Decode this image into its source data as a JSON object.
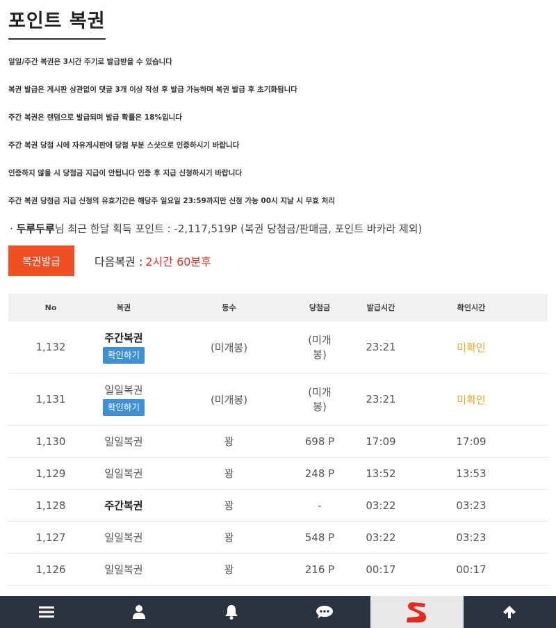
{
  "page": {
    "title": "포인트 복권"
  },
  "notices": [
    "일일/주간 복권은 3시간 주기로 발급받을 수 있습니다",
    "복권 발급은 게시판 상관없이 댓글 3개 이상 작성 후 발급 가능하며 복권 발급 후 초기화됩니다",
    "주간 복권은 랜덤으로 발급되며 발급 확률은 18%입니다",
    "주간 복권 당첨 시에 자유게시판에 당첨 부분 스샷으로 인증하시기 바랍니다",
    "인증하지 않을 시 당첨금 지급이 안됩니다 인증 후 지급 신청하시기 바랍니다",
    "주간 복권 당첨금 지급 신청의 유효기간은 해당주 일요일 23:59까지만 신청 가능 00시 지날 시 무효 처리"
  ],
  "summary": {
    "bullet": "·",
    "username": "두루두루",
    "text": "님 최근 한달 획득 포인트 : -2,117,519P (복권 당첨금/판매금, 포인트 바카라 제외)"
  },
  "issue": {
    "button_label": "복권발급",
    "next_label": "다음복권 :",
    "next_value": "2시간 60분후"
  },
  "table": {
    "headers": [
      "No",
      "복권",
      "등수",
      "당첨금",
      "발급시간",
      "확인시간"
    ],
    "check_button_label": "확인하기",
    "rows": [
      {
        "no": "1,132",
        "type": "주간복권",
        "bold": true,
        "button": true,
        "rank": "(미개봉)",
        "prize": "(미개봉)",
        "issued": "23:21",
        "checked": "미확인"
      },
      {
        "no": "1,131",
        "type": "일일복권",
        "bold": false,
        "button": true,
        "rank": "(미개봉)",
        "prize": "(미개봉)",
        "issued": "23:21",
        "checked": "미확인"
      },
      {
        "no": "1,130",
        "type": "일일복권",
        "bold": false,
        "button": false,
        "rank": "꽝",
        "prize": "698 P",
        "issued": "17:09",
        "checked": "17:09"
      },
      {
        "no": "1,129",
        "type": "일일복권",
        "bold": false,
        "button": false,
        "rank": "꽝",
        "prize": "248 P",
        "issued": "13:52",
        "checked": "13:53"
      },
      {
        "no": "1,128",
        "type": "주간복권",
        "bold": true,
        "button": false,
        "rank": "꽝",
        "prize": "-",
        "issued": "03:22",
        "checked": "03:23"
      },
      {
        "no": "1,127",
        "type": "일일복권",
        "bold": false,
        "button": false,
        "rank": "꽝",
        "prize": "548 P",
        "issued": "03:22",
        "checked": "03:23"
      },
      {
        "no": "1,126",
        "type": "일일복권",
        "bold": false,
        "button": false,
        "rank": "꽝",
        "prize": "216 P",
        "issued": "00:17",
        "checked": "00:17"
      }
    ]
  },
  "bottom_nav": {
    "items": [
      {
        "icon": "menu-icon"
      },
      {
        "icon": "user-icon"
      },
      {
        "icon": "bell-icon"
      },
      {
        "icon": "chat-icon"
      },
      {
        "icon": "logo-icon"
      },
      {
        "icon": "arrow-up-icon"
      }
    ]
  },
  "colors": {
    "accent": "#f04e23",
    "countdown": "#e8281e",
    "check_button": "#3d8fd6",
    "unconfirmed": "#f5a623",
    "nav_bg": "#2c3340"
  }
}
